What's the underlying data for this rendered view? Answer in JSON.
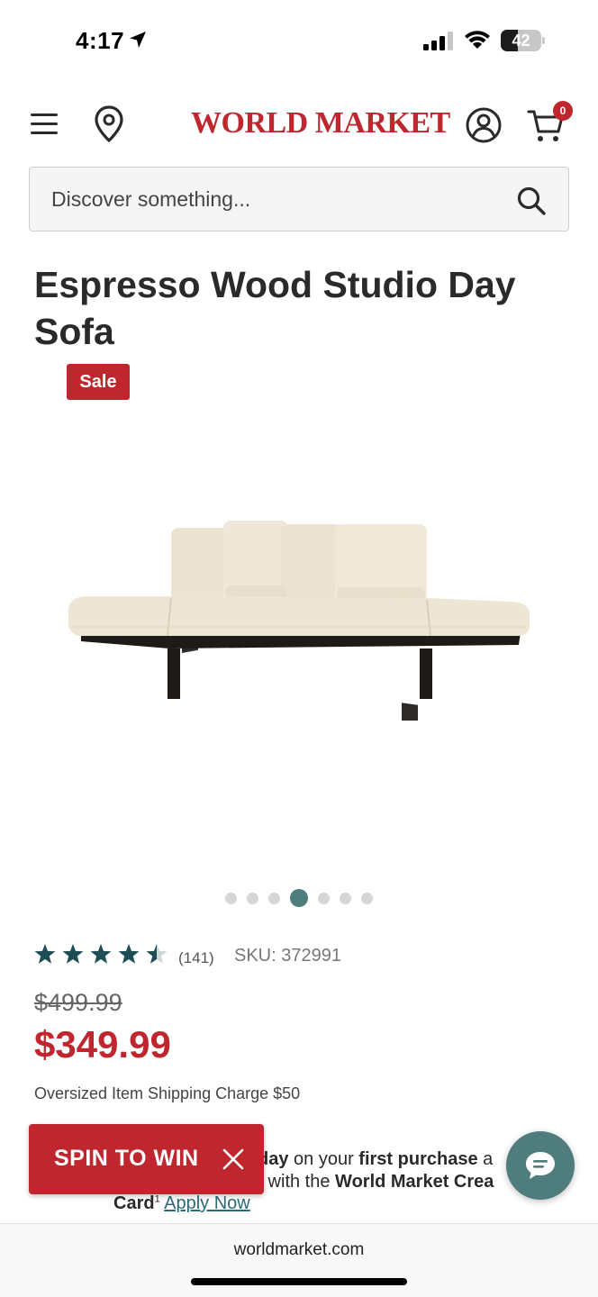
{
  "status_bar": {
    "time": "4:17",
    "battery_level": "42",
    "icons": [
      "location-arrow-icon",
      "signal-icon",
      "wifi-icon",
      "battery-icon"
    ]
  },
  "header": {
    "logo": "WORLD MARKET",
    "cart_count": "0",
    "icons": [
      "menu-icon",
      "location-pin-icon",
      "account-icon",
      "cart-icon"
    ]
  },
  "search": {
    "placeholder": "Discover something..."
  },
  "product": {
    "title": "Espresso Wood Studio Day Sofa",
    "badge": "Sale",
    "image_alt": "Espresso Wood Studio Day Sofa",
    "carousel": {
      "total": 7,
      "active_index": 3
    },
    "rating": {
      "stars": 4.5,
      "max": 5,
      "review_count": "(141)"
    },
    "sku": "SKU: 372991",
    "original_price": "$499.99",
    "sale_price": "$349.99",
    "shipping_note": "Oversized Item Shipping Charge $50"
  },
  "promo": {
    "line1_prefix": "day",
    "line1_mid": " on your ",
    "line1_bold": "first purchase",
    "line1_suffix": " a",
    "line1_tail": " with the ",
    "line1_brand": "World Market Crea",
    "line2_card": "Card",
    "line2_sup": "1",
    "apply_link": "Apply Now"
  },
  "spin_to_win": {
    "label": "SPIN TO WIN"
  },
  "browser": {
    "url": "worldmarket.com"
  },
  "colors": {
    "brand_red": "#c0262e",
    "teal": "#4f7c7c",
    "link": "#2c6a75"
  }
}
